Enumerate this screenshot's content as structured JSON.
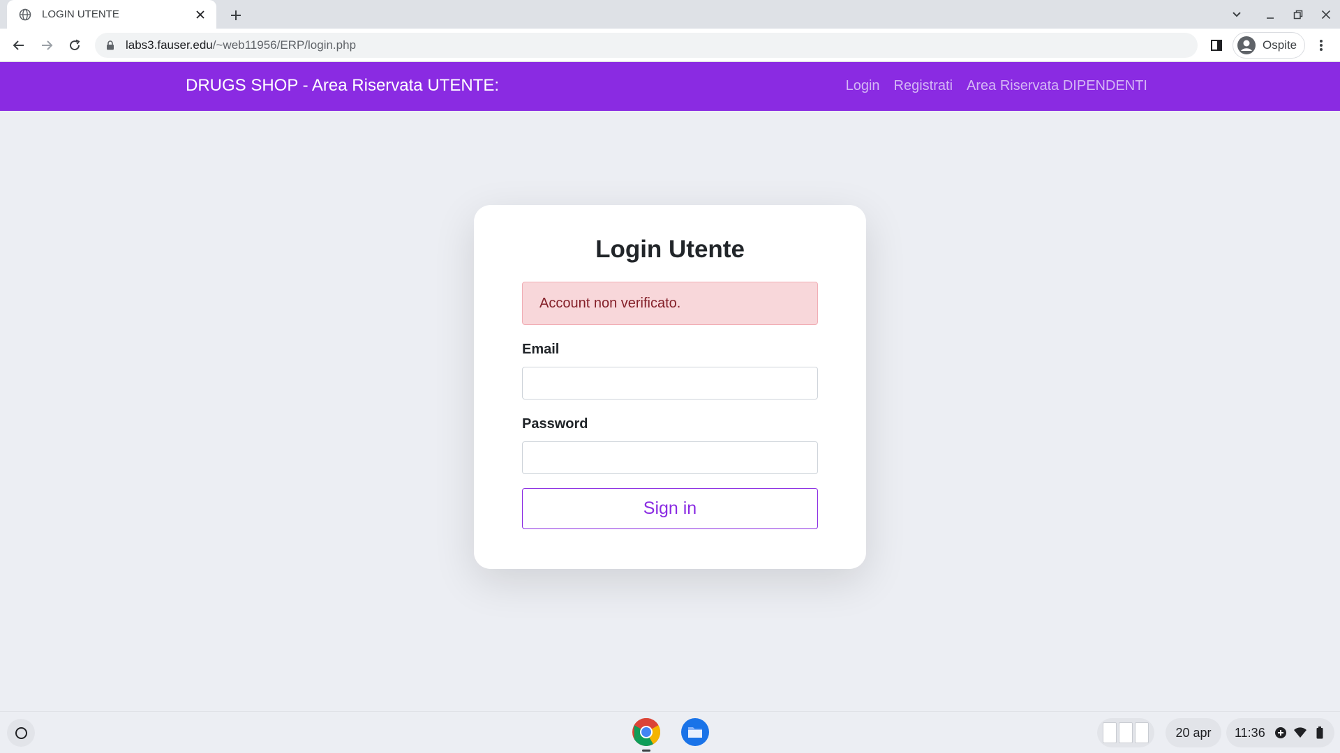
{
  "browser": {
    "tab_title": "LOGIN UTENTE",
    "url_host": "labs3.fauser.edu",
    "url_path": "/~web11956/ERP/login.php",
    "profile_name": "Ospite"
  },
  "site": {
    "brand": "DRUGS SHOP - Area Riservata UTENTE:",
    "nav": {
      "login": "Login",
      "register": "Registrati",
      "staff_area": "Area Riservata DIPENDENTI"
    },
    "accent_color": "#8a2be2"
  },
  "login_card": {
    "title": "Login Utente",
    "alert": "Account non verificato.",
    "email_label": "Email",
    "email_value": "",
    "password_label": "Password",
    "password_value": "",
    "submit_label": "Sign in"
  },
  "shelf": {
    "apps": [
      "chrome-icon",
      "files-icon"
    ],
    "date": "20 apr",
    "time": "11:36"
  }
}
